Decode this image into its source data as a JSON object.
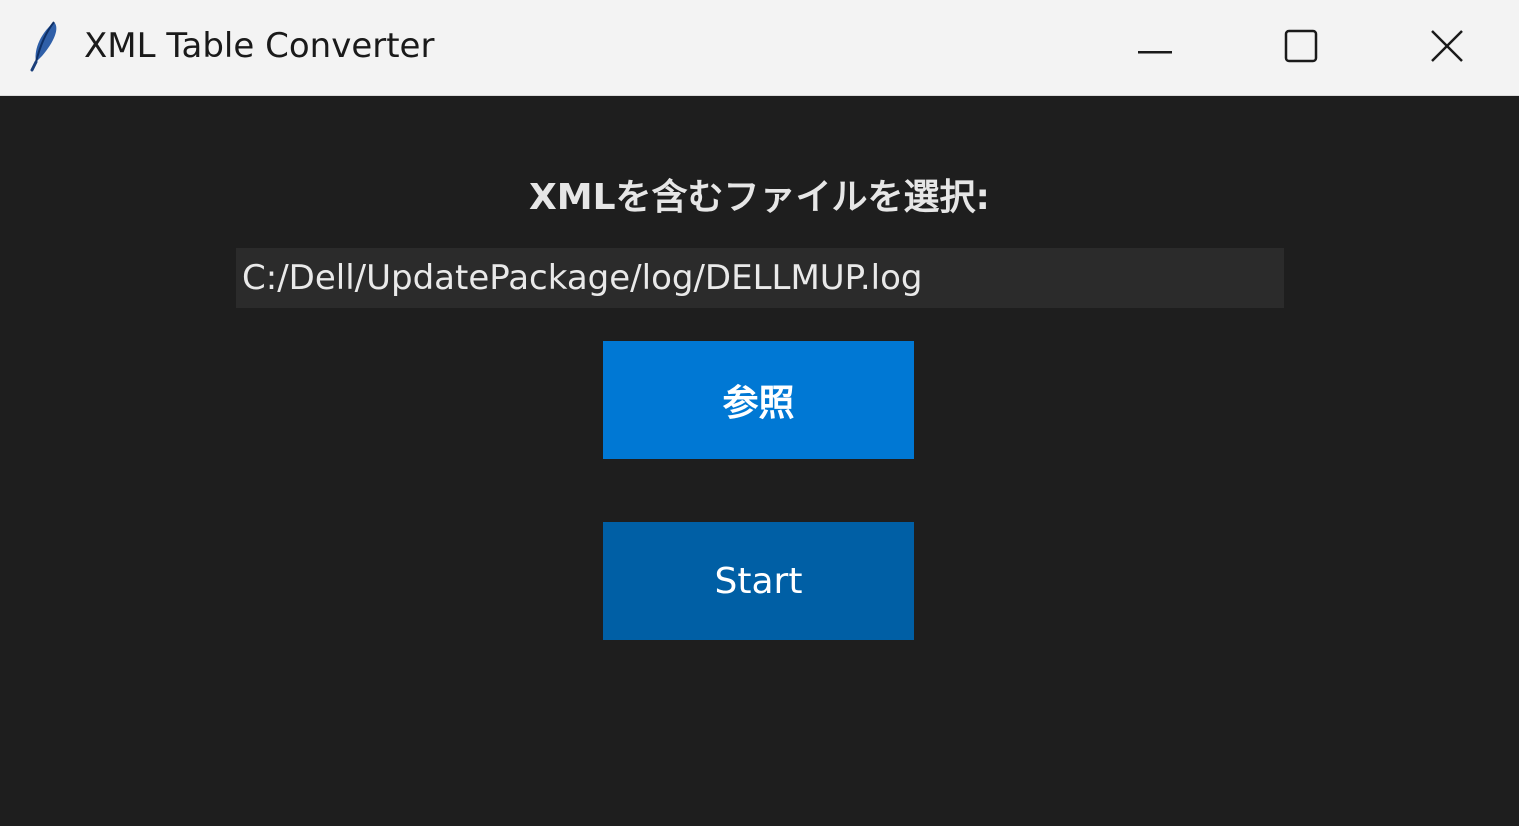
{
  "window": {
    "title": "XML Table Converter",
    "app_icon": "feather-icon",
    "controls": {
      "minimize_icon": "minimize-icon",
      "maximize_icon": "maximize-icon",
      "close_icon": "close-icon"
    }
  },
  "form": {
    "prompt_label": "XMLを含むファイルを選択:",
    "file_path_value": "C:/Dell/UpdatePackage/log/DELLMUP.log",
    "browse_button_label": "参照",
    "start_button_label": "Start"
  },
  "colors": {
    "background": "#1e1e1e",
    "titlebar": "#f3f3f3",
    "input_background": "#2b2b2b",
    "browse_button": "#0078d4",
    "start_button": "#005fa5"
  }
}
